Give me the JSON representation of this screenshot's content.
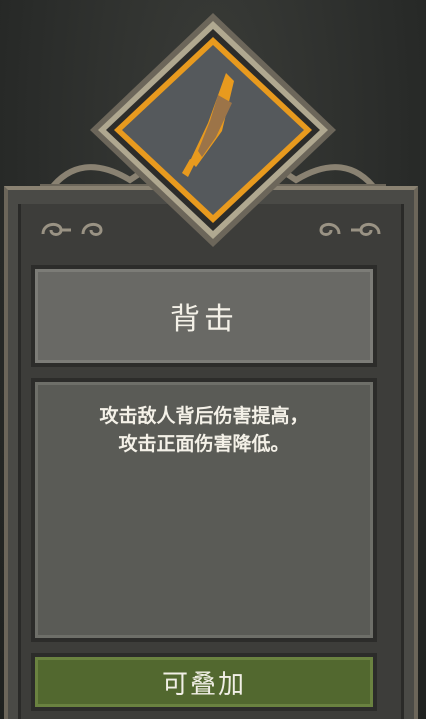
{
  "skill": {
    "name": "背击",
    "description_lines": [
      "攻击敌人背后伤害提高，",
      "攻击正面伤害降低。"
    ],
    "stack_label": "可叠加",
    "icon": "dagger-icon"
  },
  "colors": {
    "frame_gold": "#e89a1e",
    "stack_green": "#52682f",
    "panel_gray": "#696965"
  }
}
